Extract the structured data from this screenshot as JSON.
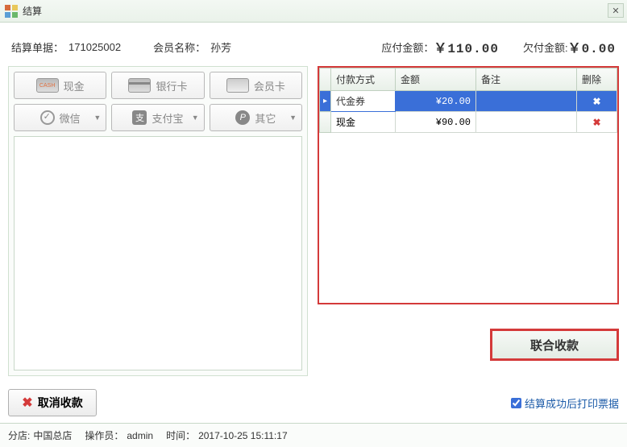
{
  "window": {
    "title": "结算"
  },
  "info": {
    "order_label": "结算单据：",
    "order_no": "171025002",
    "member_label": "会员名称：",
    "member_name": "孙芳",
    "due_label": "应付金额：",
    "due_amount": "￥110.00",
    "owe_label": "欠付金额:",
    "owe_amount": "￥0.00"
  },
  "pay_methods": {
    "cash": "现金",
    "bankcard": "银行卡",
    "membercard": "会员卡",
    "wechat": "微信",
    "alipay": "支付宝",
    "other": "其它"
  },
  "table": {
    "headers": {
      "method": "付款方式",
      "amount": "金额",
      "remark": "备注",
      "delete": "删除"
    },
    "rows": [
      {
        "method": "代金券",
        "amount": "¥20.00",
        "remark": "",
        "del": "✖"
      },
      {
        "method": "现金",
        "amount": "¥90.00",
        "remark": "",
        "del": "✖"
      }
    ]
  },
  "actions": {
    "combine": "联合收款",
    "cancel": "取消收款",
    "print_label": "结算成功后打印票据"
  },
  "status": {
    "branch_label": "分店:",
    "branch": "中国总店",
    "operator_label": "操作员：",
    "operator": "admin",
    "time_label": "时间：",
    "time": "2017-10-25 15:11:17"
  }
}
